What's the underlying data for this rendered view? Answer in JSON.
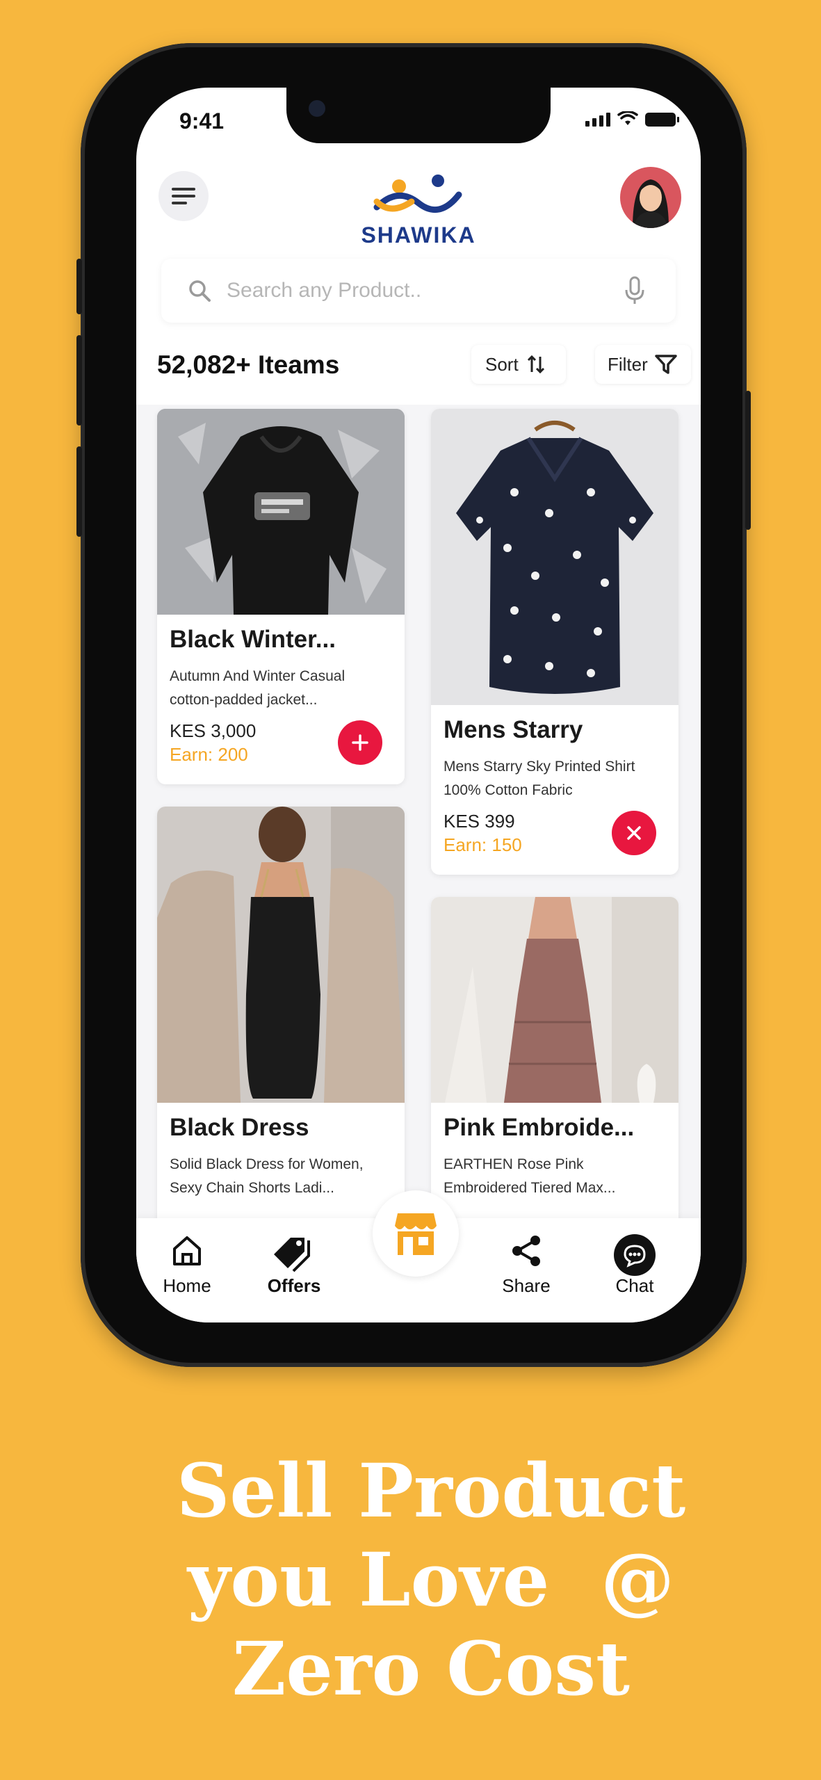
{
  "status_bar": {
    "time": "9:41"
  },
  "header": {
    "brand": "SHAWIKA"
  },
  "search": {
    "placeholder": "Search any Product.."
  },
  "toolbar": {
    "items_count": "52,082+ Iteams",
    "sort_label": "Sort",
    "filter_label": "Filter"
  },
  "products": [
    {
      "title": "Black Winter...",
      "desc_line1": "Autumn And Winter Casual",
      "desc_line2": "cotton-padded jacket...",
      "price": "KES 3,000",
      "earn": "Earn: 200",
      "action": "add"
    },
    {
      "title": "Mens Starry",
      "desc_line1": "Mens Starry Sky Printed Shirt",
      "desc_line2": "100% Cotton Fabric",
      "price": "KES 399",
      "earn": "Earn: 150",
      "action": "remove"
    },
    {
      "title": "Black Dress",
      "desc_line1": "Solid Black Dress for Women,",
      "desc_line2": "Sexy Chain Shorts Ladi..."
    },
    {
      "title": "Pink Embroide...",
      "desc_line1": "EARTHEN Rose Pink",
      "desc_line2": "Embroidered Tiered Max..."
    }
  ],
  "bottom_nav": {
    "home": "Home",
    "offers": "Offers",
    "share": "Share",
    "chat": "Chat"
  },
  "tagline": {
    "line1": "Sell Product",
    "line2": "you Love  @",
    "line3": "Zero Cost"
  },
  "colors": {
    "background": "#F7B73E",
    "accent_red": "#E8173F",
    "earn_orange": "#F5A623",
    "brand_blue": "#1d3a8a",
    "store_orange": "#F5A623"
  }
}
